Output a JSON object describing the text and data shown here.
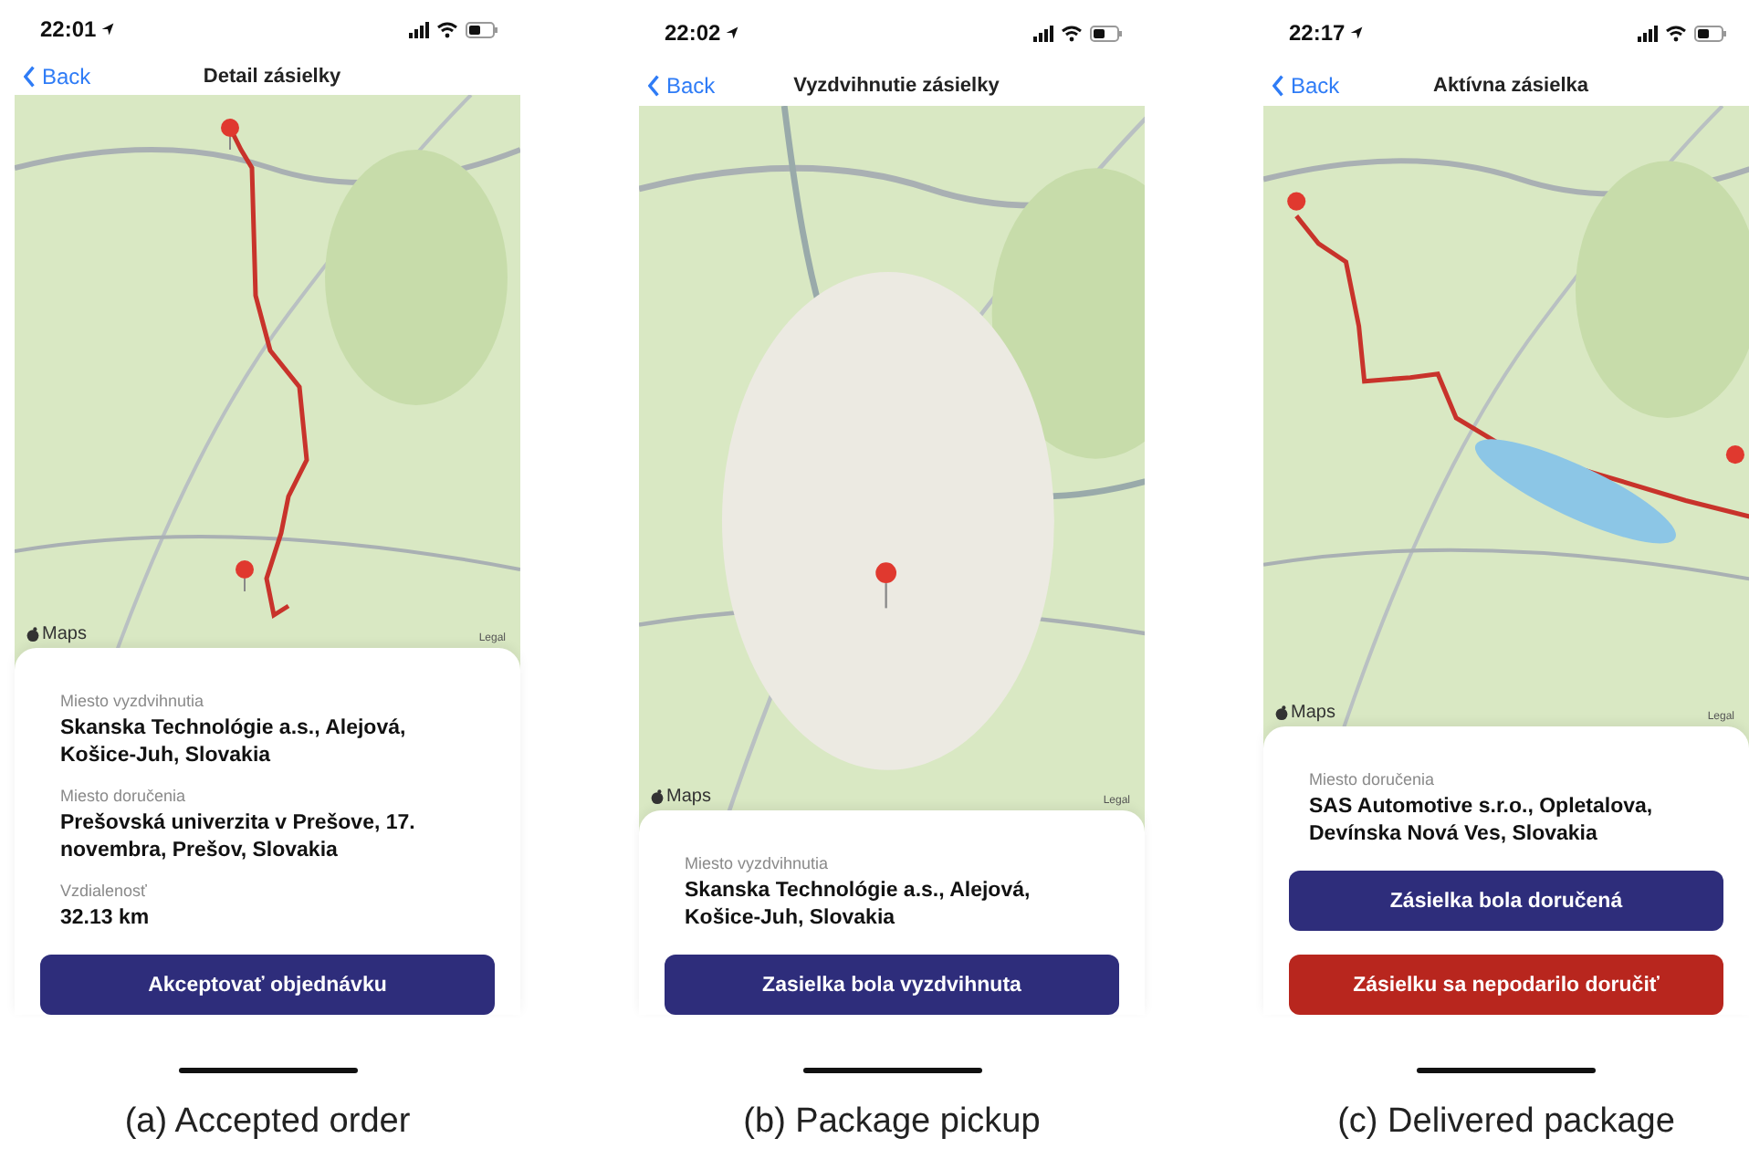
{
  "panels": [
    {
      "status_time": "22:01",
      "back": "Back",
      "title": "Detail zásielky",
      "map": {
        "kind": "route",
        "attribution": "Maps",
        "legal": "Legal"
      },
      "fields": [
        {
          "label": "Miesto vyzdvihnutia",
          "value": "Skanska Technológie a.s., Alejová, Košice-Juh, Slovakia"
        },
        {
          "label": "Miesto doručenia",
          "value": "Prešovská univerzita v Prešove, 17. novembra, Prešov, Slovakia"
        },
        {
          "label": "Vzdialenosť",
          "value": "32.13 km"
        }
      ],
      "buttons": [
        {
          "label": "Akceptovať objednávku",
          "kind": "primary"
        }
      ],
      "caption": "(a) Accepted order"
    },
    {
      "status_time": "22:02",
      "back": "Back",
      "title": "Vyzdvihnutie zásielky",
      "map": {
        "kind": "pin",
        "attribution": "Maps",
        "legal": "Legal"
      },
      "fields": [
        {
          "label": "Miesto vyzdvihnutia",
          "value": "Skanska Technológie a.s., Alejová, Košice-Juh, Slovakia"
        }
      ],
      "buttons": [
        {
          "label": "Zasielka bola vyzdvihnuta",
          "kind": "primary"
        }
      ],
      "caption": "(b) Package pickup"
    },
    {
      "status_time": "22:17",
      "back": "Back",
      "title": "Aktívna zásielka",
      "map": {
        "kind": "long_route",
        "attribution": "Maps",
        "legal": "Legal"
      },
      "fields": [
        {
          "label": "Miesto doručenia",
          "value": "SAS Automotive s.r.o., Opletalova, Devínska Nová Ves, Slovakia"
        }
      ],
      "buttons": [
        {
          "label": "Zásielka bola doručená",
          "kind": "primary"
        },
        {
          "label": "Zásielku sa nepodarilo doručiť",
          "kind": "danger"
        }
      ],
      "caption": "(c) Delivered package"
    }
  ]
}
